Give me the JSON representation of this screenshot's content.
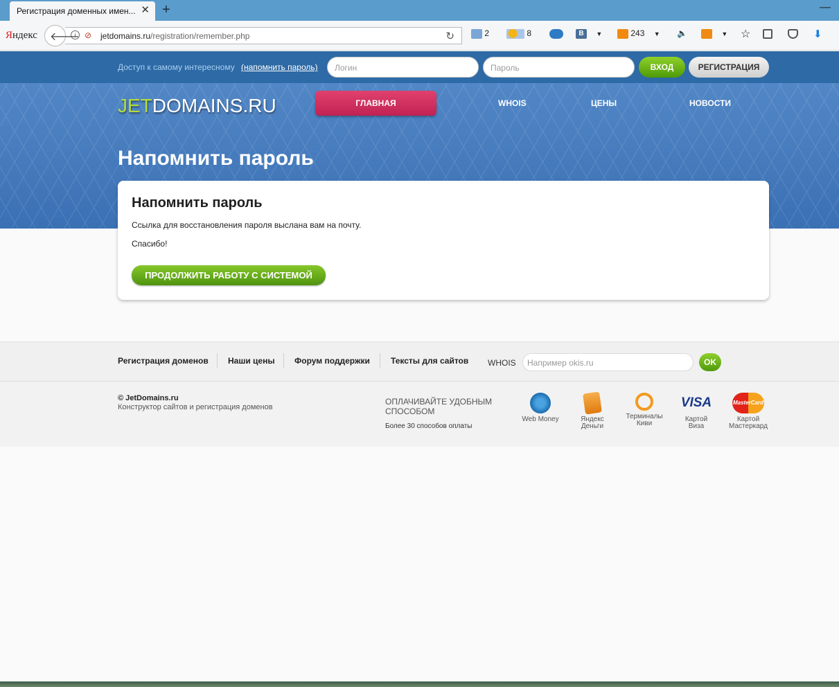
{
  "browser": {
    "tab_title": "Регистрация доменных имен...",
    "tab_close": "✕",
    "new_tab": "+",
    "minimize": "—",
    "yandex_logo_first": "Я",
    "yandex_logo_rest": "ндекс",
    "url_domain": "jetdomains.ru",
    "url_path": "/registration/remember.php",
    "toolbar": {
      "mail_count": "2",
      "weather_temp": "8",
      "vk_label": "В",
      "ok_count": "243"
    }
  },
  "topbar": {
    "access_text": "Доступ к самому интересному",
    "remind_link": "(напомнить пароль)",
    "login_placeholder": "Логин",
    "password_placeholder": "Пароль",
    "login_button": "ВХОД",
    "register_button": "РЕГИСТРАЦИЯ"
  },
  "header": {
    "logo_jet": "JET",
    "logo_rest": "DOMAINS.RU",
    "nav": [
      "ГЛАВНАЯ",
      "WHOIS",
      "ЦЕНЫ",
      "НОВОСТИ"
    ],
    "page_title": "Напомнить пароль"
  },
  "card": {
    "title": "Напомнить пароль",
    "message": "Ссылка для восстановления пароля выслана вам на почту.",
    "thanks": "Спасибо!",
    "continue_button": "ПРОДОЛЖИТЬ РАБОТУ С СИСТЕМОЙ"
  },
  "footer": {
    "links": [
      "Регистрация доменов",
      "Наши цены",
      "Форум поддержки",
      "Тексты для сайтов"
    ],
    "whois_label": "WHOIS",
    "whois_placeholder": "Например okis.ru",
    "ok_button": "OK",
    "copyright": "© JetDomains.ru",
    "copyright_sub": "Конструктор сайтов и регистрация доменов",
    "pay_title": "Оплачивайте удобным способом",
    "pay_sub": "Более 30 способов оплаты",
    "payments": [
      {
        "line1": "Web Money",
        "line2": "",
        "icon": "webmoney-icon"
      },
      {
        "line1": "Яндекс",
        "line2": "Деньги",
        "icon": "yandex-money-icon"
      },
      {
        "line1": "Терминалы",
        "line2": "Киви",
        "icon": "qiwi-icon"
      },
      {
        "line1": "Картой",
        "line2": "Виза",
        "icon": "visa-icon"
      },
      {
        "line1": "Картой",
        "line2": "Мастеркард",
        "icon": "mastercard-icon"
      }
    ]
  },
  "colors": {
    "brand_blue": "#2e6aa5",
    "accent_pink": "#c02252",
    "accent_green": "#4f9410"
  }
}
